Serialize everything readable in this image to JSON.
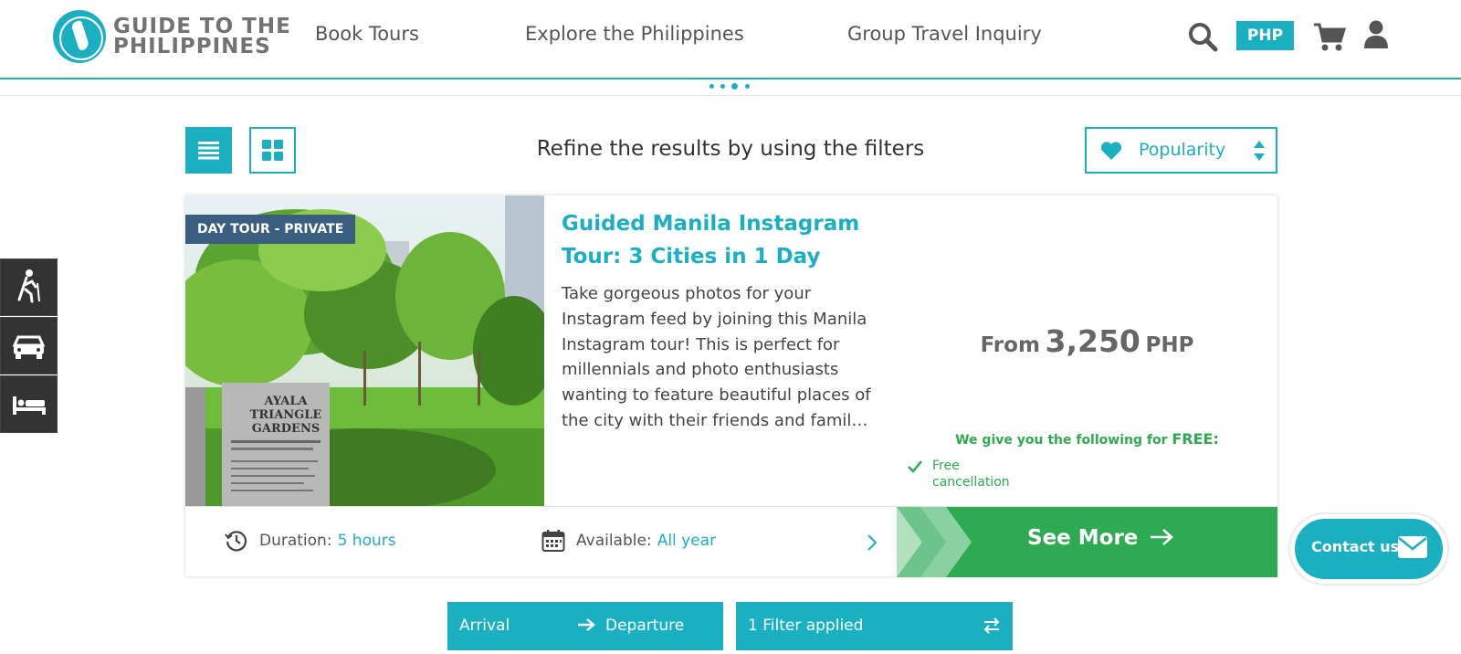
{
  "header": {
    "logo_line1": "GUIDE TO THE",
    "logo_line2": "PHILIPPINES",
    "nav": [
      "Book Tours",
      "Explore the Philippines",
      "Group Travel Inquiry"
    ],
    "currency": "PHP",
    "icons": [
      "search-icon",
      "cart-icon",
      "user-icon"
    ]
  },
  "toolbar": {
    "refine_text": "Refine the results by using the filters",
    "sort_label": "Popularity",
    "view_modes": [
      "list-view-icon",
      "grid-view-icon"
    ]
  },
  "sidebar": {
    "items": [
      "hiking-icon",
      "car-icon",
      "bed-icon"
    ]
  },
  "tour": {
    "badge": "DAY TOUR - PRIVATE",
    "title": "Guided Manila Instagram Tour: 3 Cities in 1 Day",
    "description": "Take gorgeous photos for your Instagram feed by joining this Manila Instagram tour! This is perfect for millennials and photo enthusiasts wanting to feature beautiful places of the city with their friends and famil…",
    "price_from": "From",
    "price_amount": "3,250",
    "price_currency": "PHP",
    "free_heading": "We give you the following for",
    "free_word": "FREE:",
    "free_items": [
      "Free cancellation"
    ],
    "duration_label": "Duration:",
    "duration_value": "5 hours",
    "available_label": "Available:",
    "available_value": "All year",
    "see_more": "See More",
    "photo_sign": [
      "AYALA",
      "TRIANGLE",
      "GARDENS"
    ]
  },
  "contact": {
    "label": "Contact us"
  },
  "bottom_bar": {
    "arrival": "Arrival",
    "departure": "Departure",
    "filters": "1 Filter applied"
  },
  "colors": {
    "accent": "#1ab0c1",
    "green": "#2eaa53",
    "badge": "#3a5d80",
    "sidebar": "#333333"
  }
}
